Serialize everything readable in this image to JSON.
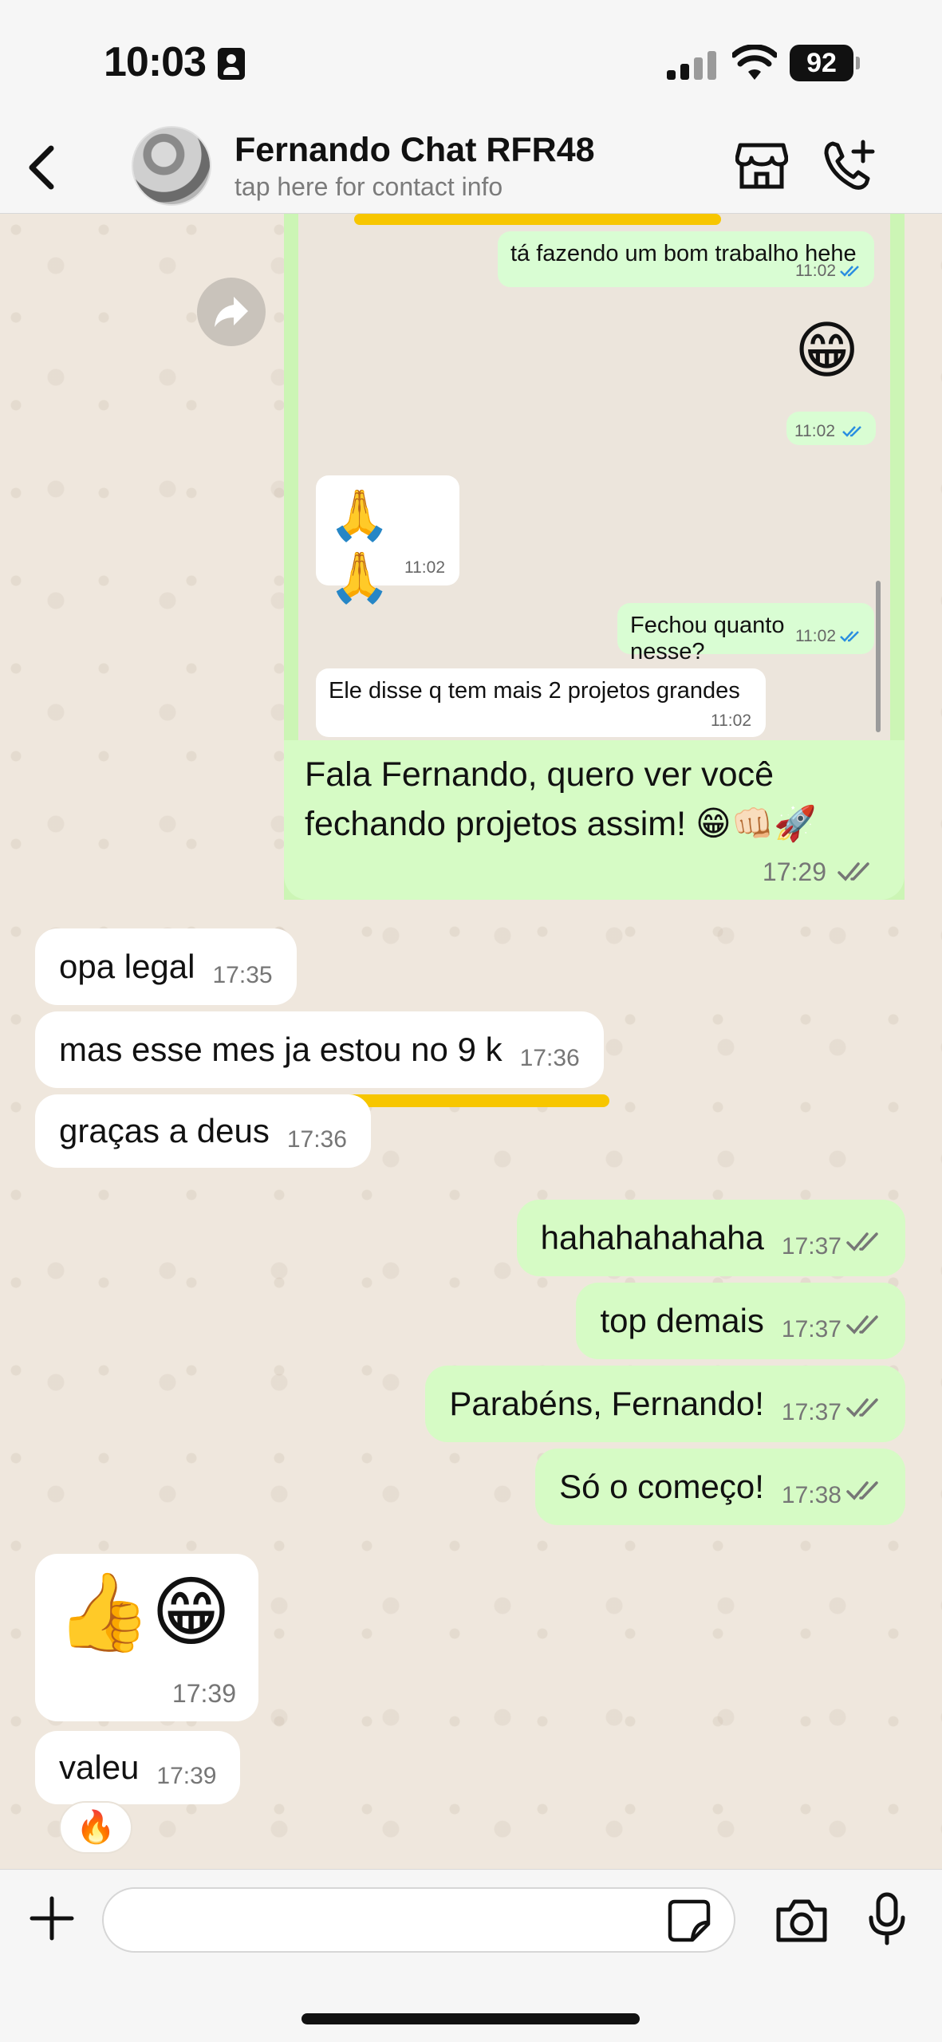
{
  "status_bar": {
    "time": "10:03",
    "battery": "92"
  },
  "header": {
    "contact_name": "Fernando Chat RFR48",
    "subtitle": "tap here for contact info"
  },
  "quoted_screenshot": {
    "messages": [
      {
        "text": "tá fazendo um bom trabalho hehe",
        "time": "11:02",
        "direction": "out"
      },
      {
        "text": "😁",
        "time": "11:02",
        "direction": "out"
      },
      {
        "text": "🙏🙏",
        "time": "11:02",
        "direction": "in"
      },
      {
        "text": "Fechou quanto nesse?",
        "time": "11:02",
        "direction": "out"
      },
      {
        "text": "Ele disse q tem mais 2 projetos grandes",
        "time": "11:02",
        "direction": "in"
      }
    ]
  },
  "messages": [
    {
      "text": "Fala Fernando, quero ver você fechando projetos assim! 😁👊🏻🚀",
      "time": "17:29",
      "direction": "out"
    },
    {
      "text": "opa legal",
      "time": "17:35",
      "direction": "in"
    },
    {
      "text": "mas esse mes ja estou no 9 k",
      "time": "17:36",
      "direction": "in"
    },
    {
      "text": "graças a deus",
      "time": "17:36",
      "direction": "in"
    },
    {
      "text": "hahahahahaha",
      "time": "17:37",
      "direction": "out"
    },
    {
      "text": "top demais",
      "time": "17:37",
      "direction": "out"
    },
    {
      "text": "Parabéns, Fernando!",
      "time": "17:37",
      "direction": "out"
    },
    {
      "text": "Só o começo!",
      "time": "17:38",
      "direction": "out"
    },
    {
      "text": "👍😁",
      "time": "17:39",
      "direction": "in"
    },
    {
      "text": "valeu",
      "time": "17:39",
      "direction": "in",
      "reaction": "🔥"
    }
  ],
  "input": {
    "placeholder": ""
  },
  "icons": {
    "back": "chevron-left-icon",
    "store": "store-icon",
    "call": "phone-plus-icon",
    "forward": "forward-icon",
    "plus": "plus-icon",
    "sticker": "sticker-icon",
    "camera": "camera-icon",
    "mic": "microphone-icon"
  },
  "colors": {
    "outgoing_bubble": "#d6fbc5",
    "incoming_bubble": "#ffffff",
    "chat_background": "#efe7dd",
    "highlight": "#f7c600",
    "read_ticks_blue": "#2a8ee0",
    "read_ticks_gray": "#767676"
  }
}
